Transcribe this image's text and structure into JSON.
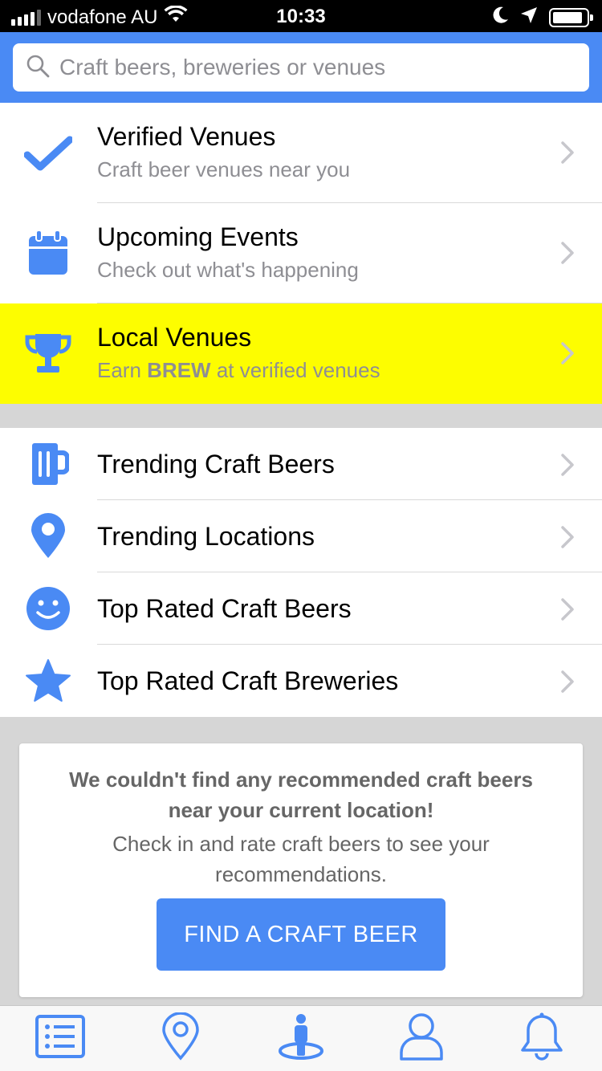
{
  "status_bar": {
    "carrier": "vodafone AU",
    "time": "10:33",
    "battery_level": 0.9
  },
  "search": {
    "placeholder": "Craft beers, breweries or venues"
  },
  "colors": {
    "brand_blue": "#4a8af4",
    "highlight_yellow": "#fdfd00",
    "separator_gray": "#d6d6d6"
  },
  "primary_menu": [
    {
      "icon": "checkmark-icon",
      "title": "Verified Venues",
      "subtitle": "Craft beer venues near you"
    },
    {
      "icon": "calendar-icon",
      "title": "Upcoming Events",
      "subtitle": "Check out what's happening"
    },
    {
      "icon": "trophy-icon",
      "title": "Local Venues",
      "subtitle_prefix": "Earn ",
      "subtitle_bold": "BREW",
      "subtitle_suffix": " at verified venues",
      "highlighted": true
    }
  ],
  "secondary_menu": [
    {
      "icon": "beer-mug-icon",
      "title": "Trending Craft Beers"
    },
    {
      "icon": "map-pin-icon",
      "title": "Trending Locations"
    },
    {
      "icon": "smiley-icon",
      "title": "Top Rated Craft Beers"
    },
    {
      "icon": "star-icon",
      "title": "Top Rated Craft Breweries"
    }
  ],
  "recommendation_card": {
    "heading": "We couldn't find any recommended craft beers near your current location!",
    "body": "Check in and rate craft beers to see your recommendations.",
    "button": "FIND A CRAFT BEER"
  },
  "tab_bar": [
    {
      "icon": "list-icon"
    },
    {
      "icon": "location-pin-icon"
    },
    {
      "icon": "person-checkin-icon"
    },
    {
      "icon": "profile-icon"
    },
    {
      "icon": "bell-icon"
    }
  ]
}
